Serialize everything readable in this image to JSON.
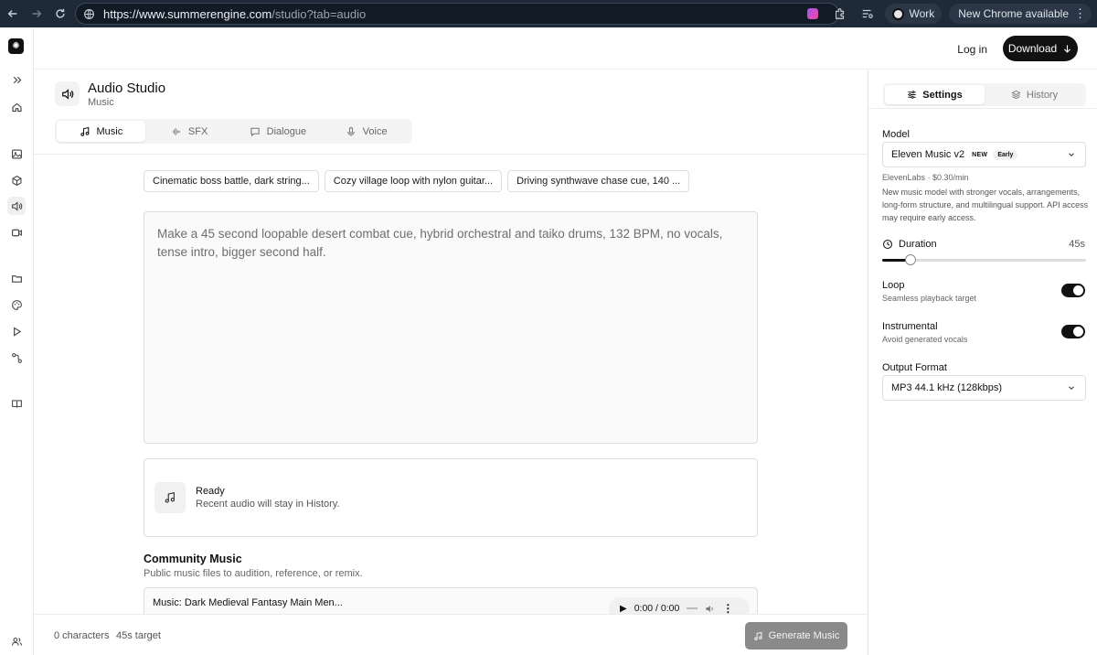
{
  "browser": {
    "url_host": "https://www.summerengine.com",
    "url_path": "/studio?tab=audio",
    "profile_label": "Work",
    "update_label": "New Chrome available"
  },
  "header": {
    "login_label": "Log in",
    "download_label": "Download"
  },
  "studio": {
    "title": "Audio Studio",
    "subtitle": "Music",
    "tabs": [
      {
        "label": "Music",
        "icon": "music-note-icon",
        "active": true
      },
      {
        "label": "SFX",
        "icon": "waveform-icon",
        "active": false
      },
      {
        "label": "Dialogue",
        "icon": "chat-bubble-icon",
        "active": false
      },
      {
        "label": "Voice",
        "icon": "microphone-icon",
        "active": false
      }
    ],
    "suggestions": [
      "Cinematic boss battle, dark string...",
      "Cozy village loop with nylon guitar...",
      "Driving synthwave chase cue, 140 ..."
    ],
    "prompt_placeholder": "Make a 45 second loopable desert combat cue, hybrid orchestral and taiko drums, 132 BPM, no vocals, tense intro, bigger second half.",
    "ready_title": "Ready",
    "ready_sub": "Recent audio will stay in History."
  },
  "community": {
    "title": "Community Music",
    "subtitle": "Public music files to audition, reference, or remix.",
    "tracks": [
      {
        "name": "Music: Dark Medieval Fantasy Main Men...",
        "time": "0:00 / 0:00"
      }
    ]
  },
  "footer": {
    "characters": "0 characters",
    "target": "45s target",
    "generate_label": "Generate Music"
  },
  "panel": {
    "tabs": [
      {
        "label": "Settings",
        "active": true
      },
      {
        "label": "History",
        "active": false
      }
    ],
    "model_label": "Model",
    "model_value": "Eleven Music v2",
    "model_badge_new": "NEW",
    "model_badge_early": "Early",
    "model_price": "ElevenLabs · $0.30/min",
    "model_description": "New music model with stronger vocals, arrangements, long-form structure, and multilingual support. API access may require early access.",
    "duration_label": "Duration",
    "duration_value": "45s",
    "duration_fraction": 0.14,
    "loop_label": "Loop",
    "loop_sub": "Seamless playback target",
    "loop_on": true,
    "instrumental_label": "Instrumental",
    "instrumental_sub": "Avoid generated vocals",
    "instrumental_on": true,
    "output_label": "Output Format",
    "output_value": "MP3 44.1 kHz (128kbps)"
  }
}
